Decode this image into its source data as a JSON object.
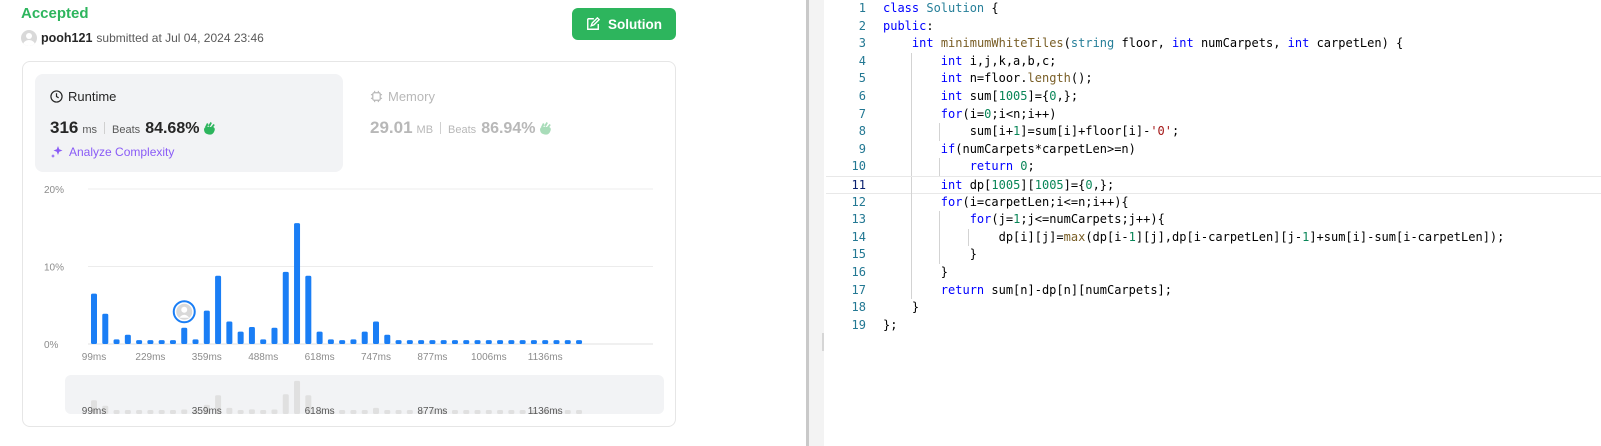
{
  "submission": {
    "status": "Accepted",
    "user": "pooh121",
    "submitted_text": "submitted at Jul 04, 2024 23:46",
    "solution_label": "Solution"
  },
  "runtime": {
    "title": "Runtime",
    "value": "316",
    "unit": "ms",
    "beats_label": "Beats",
    "beats": "84.68%",
    "analyze_label": "Analyze Complexity"
  },
  "memory": {
    "title": "Memory",
    "value": "29.01",
    "unit": "MB",
    "beats_label": "Beats",
    "beats": "86.94%"
  },
  "colors": {
    "accent_green": "#2db55d",
    "bar_blue": "#1a7ef5",
    "analyze_purple": "#8a5cf6"
  },
  "chart_data": {
    "type": "bar",
    "ylim": [
      0,
      20
    ],
    "y_ticks": [
      "20%",
      "10%",
      "0%"
    ],
    "y_tick_values": [
      20,
      10,
      0
    ],
    "x_tick_labels": [
      "99ms",
      "229ms",
      "359ms",
      "488ms",
      "618ms",
      "747ms",
      "877ms",
      "1006ms",
      "1136ms"
    ],
    "x_tick_index": [
      0,
      5,
      10,
      15,
      20,
      25,
      30,
      35,
      40
    ],
    "values": [
      6.5,
      3.9,
      0.6,
      1.2,
      0.5,
      0.5,
      0.5,
      0.5,
      2.1,
      0.6,
      4.3,
      8.8,
      2.9,
      1.6,
      2.2,
      0.6,
      2.1,
      9.3,
      15.6,
      8.8,
      1.6,
      0.6,
      0.5,
      0.6,
      1.6,
      2.9,
      1.2,
      0.5,
      0.5,
      0.5,
      0.5,
      0.5,
      0.5,
      0.5,
      0.5,
      0.5,
      0.5,
      0.5,
      0.5,
      0.5,
      0.5,
      0.5,
      0.5,
      0.5
    ],
    "user_bar_index": 8,
    "mini_tick_labels": [
      "99ms",
      "359ms",
      "618ms",
      "877ms",
      "1136ms"
    ],
    "mini_tick_index": [
      0,
      10,
      20,
      30,
      40
    ]
  },
  "code": {
    "lines": [
      "class Solution {",
      "public:",
      "    int minimumWhiteTiles(string floor, int numCarpets, int carpetLen) {",
      "        int i,j,k,a,b,c;",
      "        int n=floor.length();",
      "        int sum[1005]={0,};",
      "        for(i=0;i<n;i++)",
      "            sum[i+1]=sum[i]+floor[i]-'0';",
      "        if(numCarpets*carpetLen>=n)",
      "            return 0;",
      "        int dp[1005][1005]={0,};",
      "        for(i=carpetLen;i<=n;i++){",
      "            for(j=1;j<=numCarpets;j++){",
      "                dp[i][j]=max(dp[i-1][j],dp[i-carpetLen][j-1]+sum[i]-sum[i-carpetLen]);",
      "            }",
      "        }",
      "        return sum[n]-dp[n][numCarpets];",
      "    }",
      "};"
    ],
    "current_line": 11
  }
}
